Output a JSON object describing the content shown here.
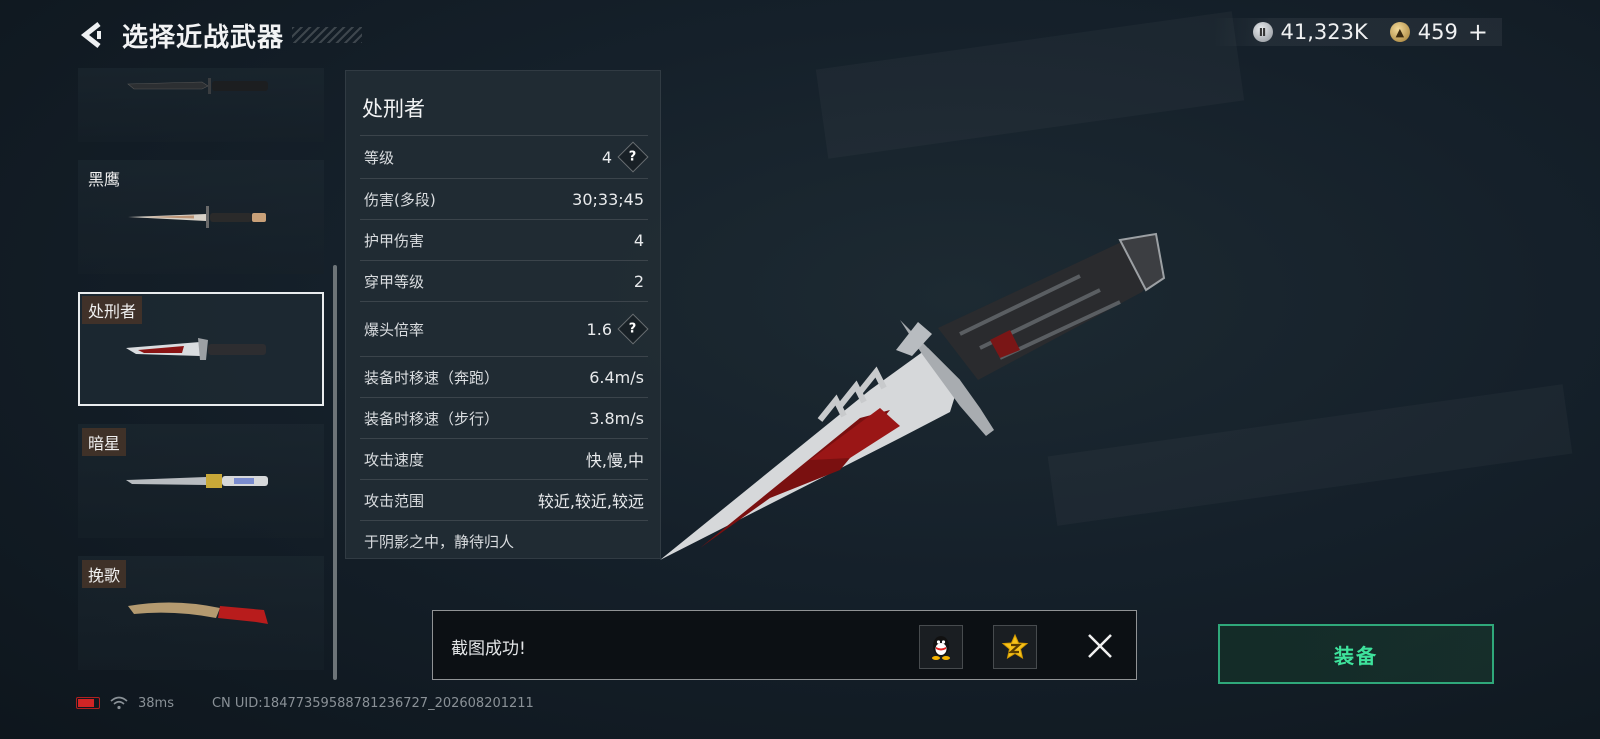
{
  "header": {
    "title": "选择近战武器"
  },
  "currency": {
    "silver": "41,323K",
    "gold": "459",
    "plus": "+"
  },
  "weapons": [
    {
      "name": ""
    },
    {
      "name": "黑鹰"
    },
    {
      "name": "处刑者",
      "selected": true
    },
    {
      "name": "暗星"
    },
    {
      "name": "挽歌"
    }
  ],
  "details": {
    "name": "处刑者",
    "stats": [
      {
        "label": "等级",
        "value": "4",
        "help": "?"
      },
      {
        "label": "伤害(多段)",
        "value": "30;33;45"
      },
      {
        "label": "护甲伤害",
        "value": "4"
      },
      {
        "label": "穿甲等级",
        "value": "2"
      },
      {
        "label": "爆头倍率",
        "value": "1.6",
        "help": "?"
      },
      {
        "label": "装备时移速（奔跑）",
        "value": "6.4m/s"
      },
      {
        "label": "装备时移速（步行）",
        "value": "3.8m/s"
      },
      {
        "label": "攻击速度",
        "value": "快,慢,中"
      },
      {
        "label": "攻击范围",
        "value": "较近,较近,较远"
      }
    ],
    "flavor": "于阴影之中，静待归人"
  },
  "toast": {
    "message": "截图成功!"
  },
  "equip": {
    "label": "装备"
  },
  "status": {
    "ping": "38ms",
    "uid": "CN UID:1847735958878123672​7_202608201211"
  },
  "colors": {
    "accent": "#3ee29c",
    "battery": "#d02525",
    "panel": "#222c34"
  }
}
